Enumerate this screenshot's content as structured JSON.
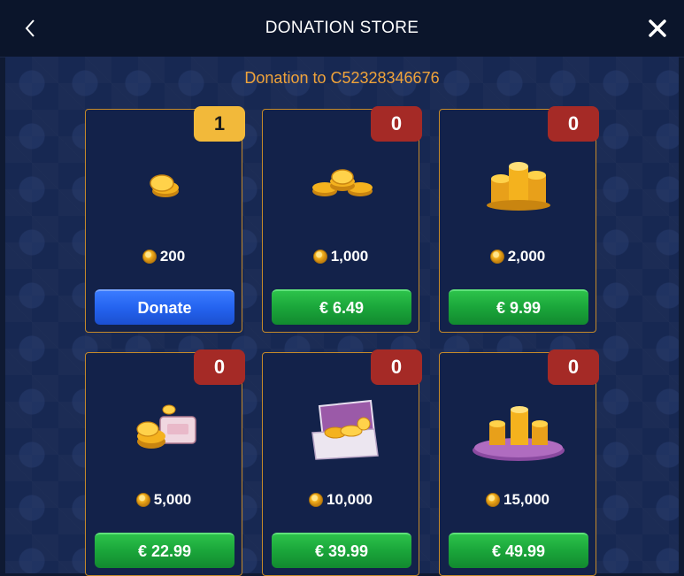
{
  "header": {
    "title": "DONATION STORE",
    "back_icon": "chevron-left-icon",
    "close_icon": "close-icon"
  },
  "main": {
    "subtitle": "Donation to C52328346676"
  },
  "cards": [
    {
      "badge": "1",
      "amount": "200",
      "button": "Donate"
    },
    {
      "badge": "0",
      "amount": "1,000",
      "button": "€ 6.49"
    },
    {
      "badge": "0",
      "amount": "2,000",
      "button": "€ 9.99"
    },
    {
      "badge": "0",
      "amount": "5,000",
      "button": "€ 22.99"
    },
    {
      "badge": "0",
      "amount": "10,000",
      "button": "€ 39.99"
    },
    {
      "badge": "0",
      "amount": "15,000",
      "button": "€ 49.99"
    }
  ],
  "colors": {
    "accent": "#f0a33a",
    "badge_red": "#a52a26",
    "badge_gold": "#f2b93a",
    "button_green": "#1aa53a",
    "button_blue": "#2463ef"
  }
}
